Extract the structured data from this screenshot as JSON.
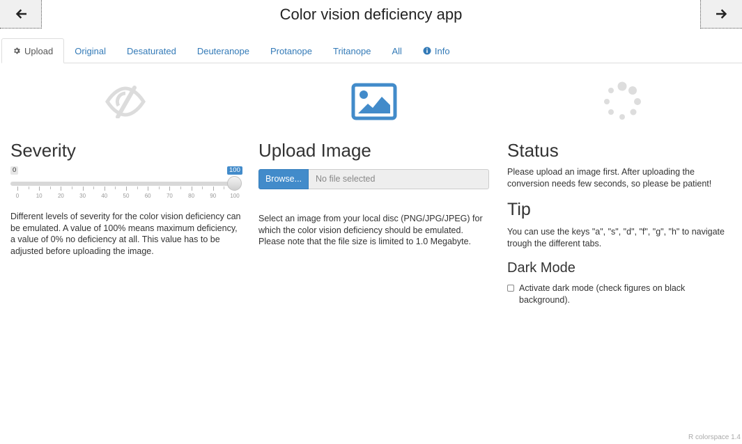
{
  "header": {
    "title": "Color vision deficiency app",
    "prev_icon": "arrow-left-icon",
    "next_icon": "arrow-right-icon"
  },
  "tabs": [
    {
      "label": "Upload",
      "icon": "gear-icon",
      "active": true
    },
    {
      "label": "Original"
    },
    {
      "label": "Desaturated"
    },
    {
      "label": "Deuteranope"
    },
    {
      "label": "Protanope"
    },
    {
      "label": "Tritanope"
    },
    {
      "label": "All"
    },
    {
      "label": "Info",
      "icon": "info-circle-icon"
    }
  ],
  "severity": {
    "icon": "eye-slash-icon",
    "heading": "Severity",
    "slider": {
      "min": "0",
      "value": "100",
      "tick_labels": [
        "0",
        "10",
        "20",
        "30",
        "40",
        "50",
        "60",
        "70",
        "80",
        "90",
        "100"
      ]
    },
    "description": "Different levels of severity for the color vision deficiency can be emulated. A value of 100% means maximum deficiency, a value of 0% no deficiency at all. This value has to be adjusted before uploading the image."
  },
  "upload": {
    "icon": "image-icon",
    "heading": "Upload Image",
    "browse_label": "Browse...",
    "file_placeholder": "No file selected",
    "description": "Select an image from your local disc (PNG/JPG/JPEG) for which the color vision deficiency should be emulated. Please note that the file size is limited to 1.0 Megabyte."
  },
  "status": {
    "icon": "spinner-icon",
    "heading": "Status",
    "text": "Please upload an image first. After uploading the conversion needs few seconds, so please be patient!",
    "tip_heading": "Tip",
    "tip_text": "You can use the keys \"a\", \"s\", \"d\", \"f\", \"g\", \"h\" to navigate trough the different tabs.",
    "dark_heading": "Dark Mode",
    "dark_label": "Activate dark mode (check figures on black background).",
    "dark_checked": false
  },
  "footer": {
    "text": "R colorspace 1.4"
  },
  "colors": {
    "accent": "#428bca",
    "link": "#337ab7",
    "icon_gray": "#dddddd"
  }
}
